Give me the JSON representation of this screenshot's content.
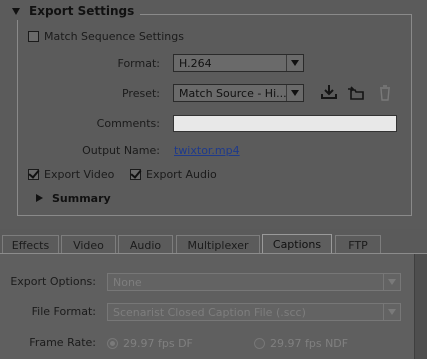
{
  "export_settings": {
    "title": "Export Settings",
    "match_sequence": {
      "label": "Match Sequence Settings",
      "checked": false
    },
    "format": {
      "label": "Format:",
      "value": "H.264"
    },
    "preset": {
      "label": "Preset:",
      "value": "Match Source - Hi..."
    },
    "preset_icons": [
      "save-preset-icon",
      "import-preset-icon",
      "delete-preset-icon"
    ],
    "comments": {
      "label": "Comments:",
      "value": ""
    },
    "output_name": {
      "label": "Output Name:",
      "value": "twixtor.mp4"
    },
    "export_video": {
      "label": "Export Video",
      "checked": true
    },
    "export_audio": {
      "label": "Export Audio",
      "checked": true
    },
    "summary": {
      "label": "Summary"
    }
  },
  "tabs": [
    {
      "label": "Effects",
      "active": false
    },
    {
      "label": "Video",
      "active": false
    },
    {
      "label": "Audio",
      "active": false
    },
    {
      "label": "Multiplexer",
      "active": false
    },
    {
      "label": "Captions",
      "active": true
    },
    {
      "label": "FTP",
      "active": false
    }
  ],
  "captions": {
    "export_options": {
      "label": "Export Options:",
      "value": "None"
    },
    "file_format": {
      "label": "File Format:",
      "value": "Scenarist Closed Caption File (.scc)"
    },
    "frame_rate": {
      "label": "Frame Rate:",
      "options": [
        {
          "label": "29.97 fps DF",
          "selected": true
        },
        {
          "label": "29.97 fps NDF",
          "selected": false
        }
      ]
    }
  },
  "colors": {
    "panel_bg": "#5b5b5b",
    "link": "#1e3a8c",
    "disabled_text": "#808080"
  }
}
